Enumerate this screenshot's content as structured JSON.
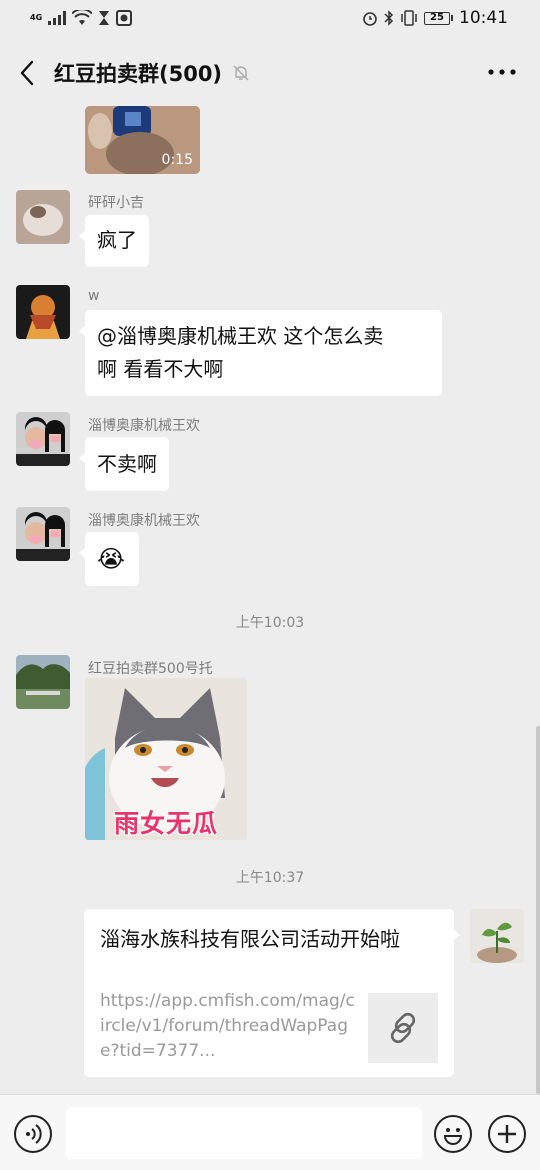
{
  "status_bar": {
    "network": "4G",
    "battery": "25",
    "time": "10:41"
  },
  "header": {
    "title": "红豆拍卖群(500)",
    "icons": [
      "back-arrow-icon",
      "mute-bell-icon",
      "more-dots-icon"
    ]
  },
  "messages": {
    "video": {
      "duration": "0:15"
    },
    "msg1": {
      "sender": "砰砰小吉",
      "text": "疯了"
    },
    "msg2": {
      "sender": "w",
      "text_line1": "@淄博奥康机械王欢  这个怎么卖",
      "text_line2": "啊 看看不大啊"
    },
    "msg3": {
      "sender": "淄博奥康机械王欢",
      "text": "不卖啊"
    },
    "msg4": {
      "sender": "淄博奥康机械王欢",
      "emoji": "😭"
    },
    "time1": "上午10:03",
    "msg5": {
      "sender": "红豆拍卖群500号托",
      "sticker_caption": "雨女无瓜"
    },
    "time2": "上午10:37",
    "link": {
      "title": "淄海水族科技有限公司活动开始啦",
      "url": "https://app.cmfish.com/mag/circle/v1/forum/threadWapPage?tid=7377..."
    }
  },
  "colors": {
    "background": "#ededed",
    "bubble": "#ffffff",
    "sticker_text": "#e8336b"
  }
}
